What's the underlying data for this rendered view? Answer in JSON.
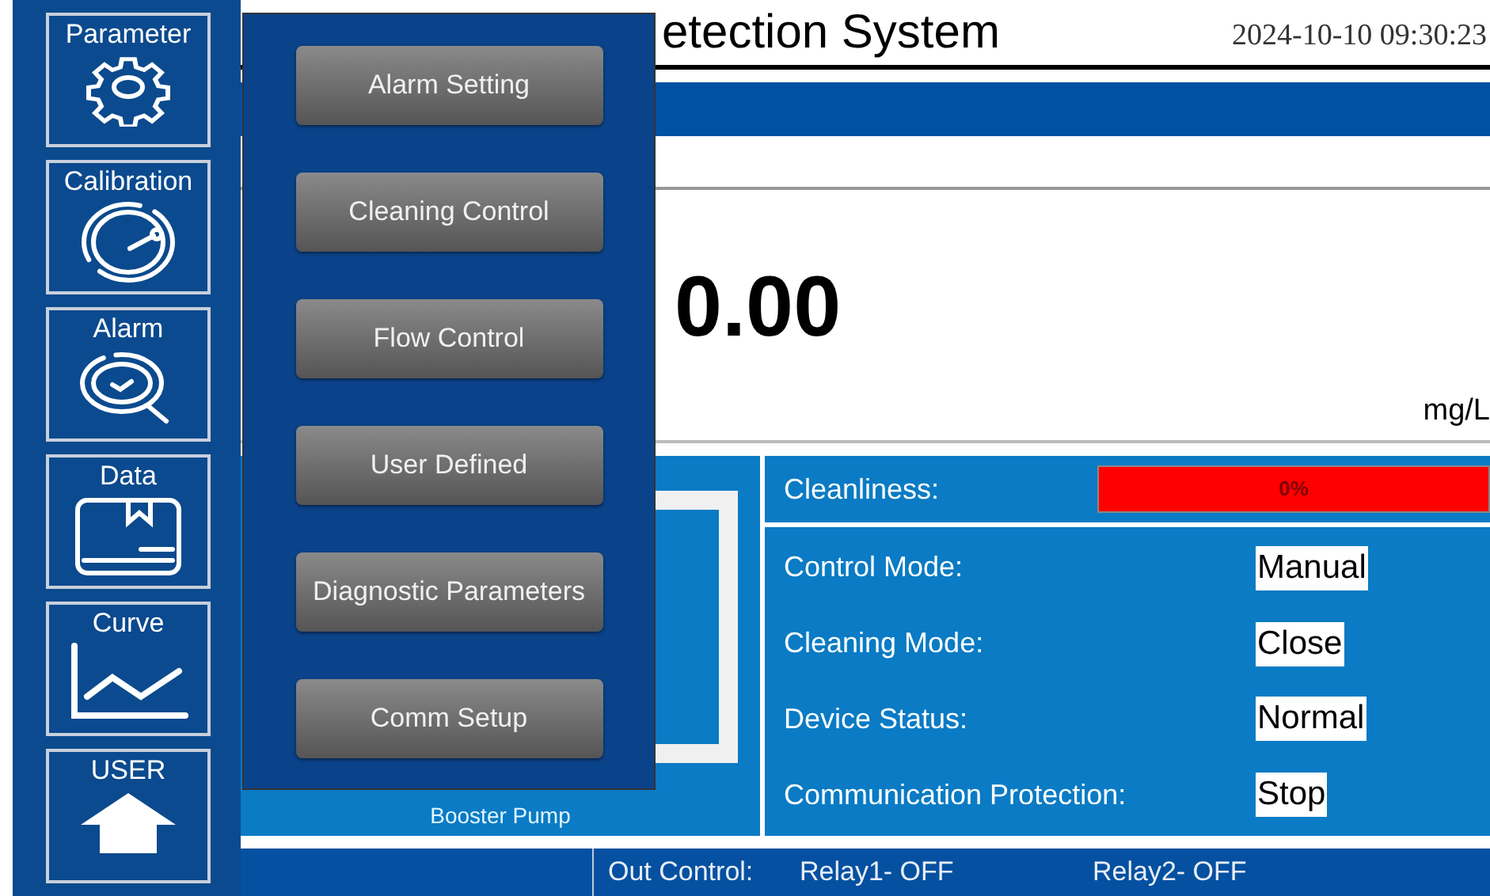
{
  "sidebar": {
    "items": [
      {
        "label": "Parameter",
        "kind": "gear"
      },
      {
        "label": "Calibration",
        "kind": "gauge"
      },
      {
        "label": "Alarm",
        "kind": "alarm"
      },
      {
        "label": "Data",
        "kind": "data"
      },
      {
        "label": "Curve",
        "kind": "curve"
      },
      {
        "label": "USER",
        "kind": "home"
      }
    ]
  },
  "menu": {
    "items": [
      "Alarm Setting",
      "Cleaning Control",
      "Flow Control",
      "User Defined",
      "Diagnostic Parameters",
      "Comm Setup"
    ]
  },
  "header": {
    "title": "etection System",
    "datetime": "2024-10-10 09:30:23"
  },
  "reading": {
    "value": "0.00",
    "unit": "mg/L"
  },
  "pump": {
    "label": "Booster Pump"
  },
  "cleanliness": {
    "label": "Cleanliness:",
    "reading": "0%"
  },
  "status": [
    {
      "label": "Control Mode:",
      "value": "Manual"
    },
    {
      "label": "Cleaning Mode:",
      "value": "Close"
    },
    {
      "label": "Device Status:",
      "value": "Normal"
    },
    {
      "label": "Communication Protection:",
      "value": "Stop"
    }
  ],
  "footer": {
    "label": "Out Control:",
    "relays": [
      "Relay1- OFF",
      "Relay2- OFF"
    ]
  }
}
